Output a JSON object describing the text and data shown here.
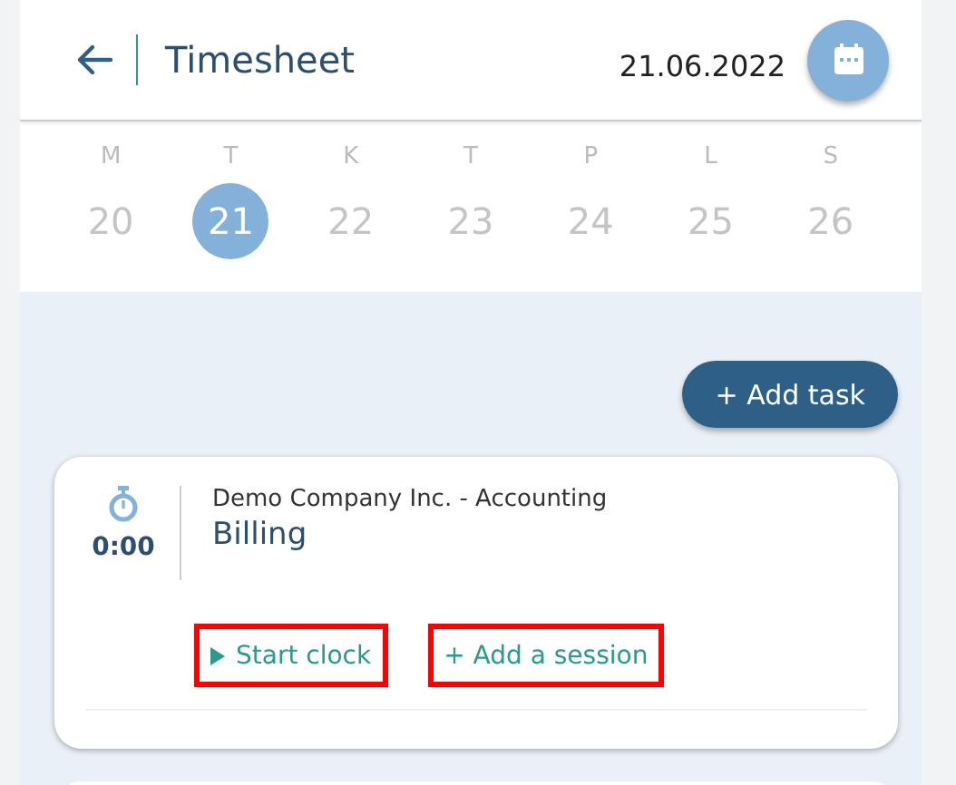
{
  "header": {
    "title": "Timesheet",
    "date": "21.06.2022"
  },
  "week": [
    {
      "weekday": "M",
      "day": "20",
      "selected": false
    },
    {
      "weekday": "T",
      "day": "21",
      "selected": true
    },
    {
      "weekday": "K",
      "day": "22",
      "selected": false
    },
    {
      "weekday": "T",
      "day": "23",
      "selected": false
    },
    {
      "weekday": "P",
      "day": "24",
      "selected": false
    },
    {
      "weekday": "L",
      "day": "25",
      "selected": false
    },
    {
      "weekday": "S",
      "day": "26",
      "selected": false
    }
  ],
  "add_task": {
    "label": "+ Add task"
  },
  "tasks": [
    {
      "time": "0:00",
      "project": "Demo Company Inc. - Accounting",
      "task": "Billing",
      "actions": [
        {
          "kind": "start",
          "label": "Start clock",
          "highlighted": true
        },
        {
          "kind": "add",
          "label": "+ Add a session",
          "highlighted": true
        }
      ]
    }
  ]
}
